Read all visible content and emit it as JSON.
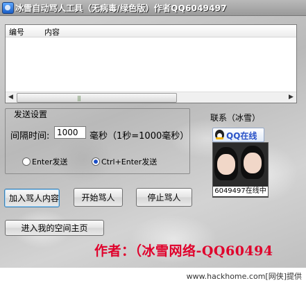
{
  "window": {
    "title": "冰雪自动骂人工具（无病毒/绿色版）作者QQ6049497"
  },
  "list": {
    "columns": [
      "编号",
      "内容"
    ],
    "rows": [],
    "scroll_grip": "|||"
  },
  "settings": {
    "group_label": "发送设置",
    "interval_label": "间隔时间:",
    "interval_value": "1000",
    "unit_label": "毫秒（1秒=1000毫秒）",
    "send_modes": [
      {
        "label": "Enter发送",
        "selected": false
      },
      {
        "label": "Ctrl+Enter发送",
        "selected": true
      }
    ]
  },
  "contact": {
    "label": "联系（冰雪）",
    "qq_status": "QQ在线",
    "avatar_caption": "6049497在线中"
  },
  "buttons": {
    "add_content": "加入骂人内容",
    "start": "开始骂人",
    "stop": "停止骂人",
    "homepage": "进入我的空间主页"
  },
  "banner": {
    "author_text": "作者：（冰雪网络-QQ60494"
  },
  "footer": {
    "credit": "www.hackhome.com[网侠]提供"
  },
  "colors": {
    "author_text": "#e0002b",
    "qq_text": "#2a53c8"
  },
  "icons": [
    "app-icon",
    "qq-penguin-icon",
    "radio-icon",
    "scroll-left-arrow-icon",
    "scroll-right-arrow-icon"
  ]
}
